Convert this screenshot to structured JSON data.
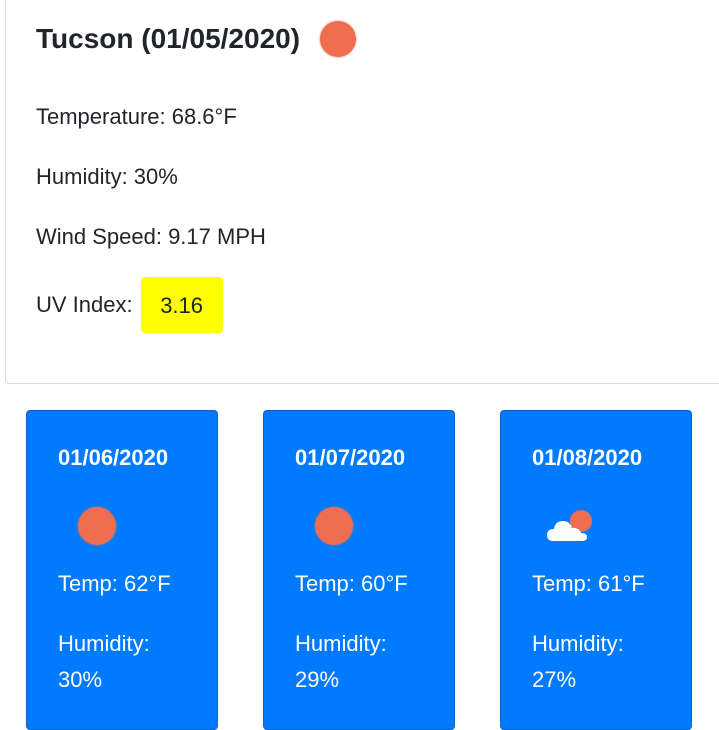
{
  "current": {
    "title": "Tucson (01/05/2020)",
    "icon": "sun-icon",
    "temperature": "Temperature: 68.6°F",
    "humidity": "Humidity: 30%",
    "wind_speed": "Wind Speed: 9.17 MPH",
    "uv_label": "UV Index:",
    "uv_value": "3.16"
  },
  "forecast": [
    {
      "date": "01/06/2020",
      "icon": "sun-icon",
      "temp": "Temp: 62°F",
      "humidity_label": "Humidity:",
      "humidity_value": "30%"
    },
    {
      "date": "01/07/2020",
      "icon": "sun-icon",
      "temp": "Temp: 60°F",
      "humidity_label": "Humidity:",
      "humidity_value": "29%"
    },
    {
      "date": "01/08/2020",
      "icon": "cloud-sun-icon",
      "temp": "Temp: 61°F",
      "humidity_label": "Humidity:",
      "humidity_value": "27%"
    }
  ],
  "colors": {
    "sun": "#ee6e4f",
    "card_blue": "#007bff",
    "uv_highlight": "#ffff00"
  }
}
